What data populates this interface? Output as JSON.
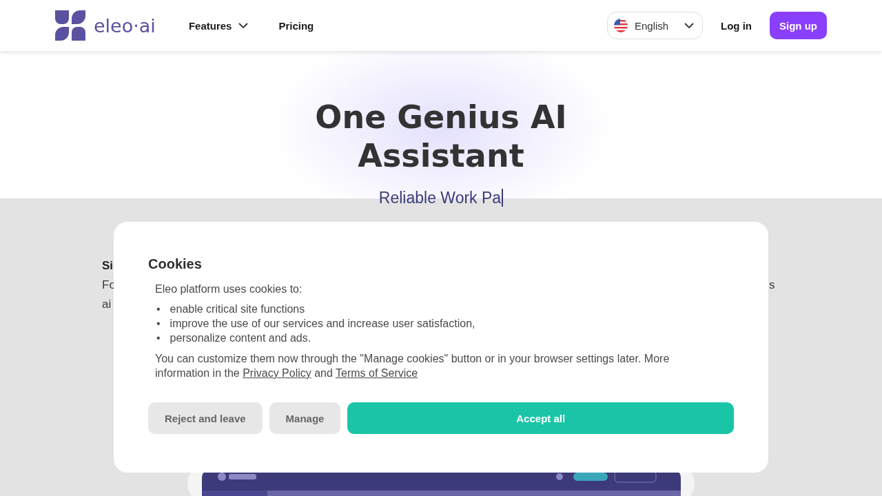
{
  "header": {
    "logo": "eleo·ai",
    "nav": [
      {
        "label": "Features",
        "kind": "dropdown"
      },
      {
        "label": "Pricing",
        "kind": "link"
      }
    ],
    "language": "English",
    "login": "Log in",
    "signup": "Sign up"
  },
  "hero": {
    "title": "One Genius AI Assistant",
    "subtitle": "Reliable Work Pa"
  },
  "background_texts": {
    "left": [
      {
        "text": "Si",
        "kind": "heading"
      },
      {
        "text": "Fo",
        "kind": "body"
      },
      {
        "text": "ai",
        "kind": "body"
      }
    ],
    "right": "s"
  },
  "cookies": {
    "title": "Cookies",
    "intro": "Eleo platform uses cookies to:",
    "items": [
      {
        "marker": "•",
        "text": "enable critical site functions"
      },
      {
        "marker": "•",
        "text": "improve the use of our services and increase user satisfaction,"
      },
      {
        "marker": "•",
        "text": "personalize content and ads."
      }
    ],
    "note": "You can customize them now through the \"Manage cookies\" button or in your browser settings later. More information in the ",
    "privacy_link": "Privacy Policy",
    "between": " and ",
    "terms_link": "Terms of Service",
    "buttons": [
      {
        "label": "Reject and leave",
        "kind": "secondary"
      },
      {
        "label": "Manage",
        "kind": "secondary"
      },
      {
        "label": "Accept all",
        "kind": "primary"
      }
    ]
  }
}
